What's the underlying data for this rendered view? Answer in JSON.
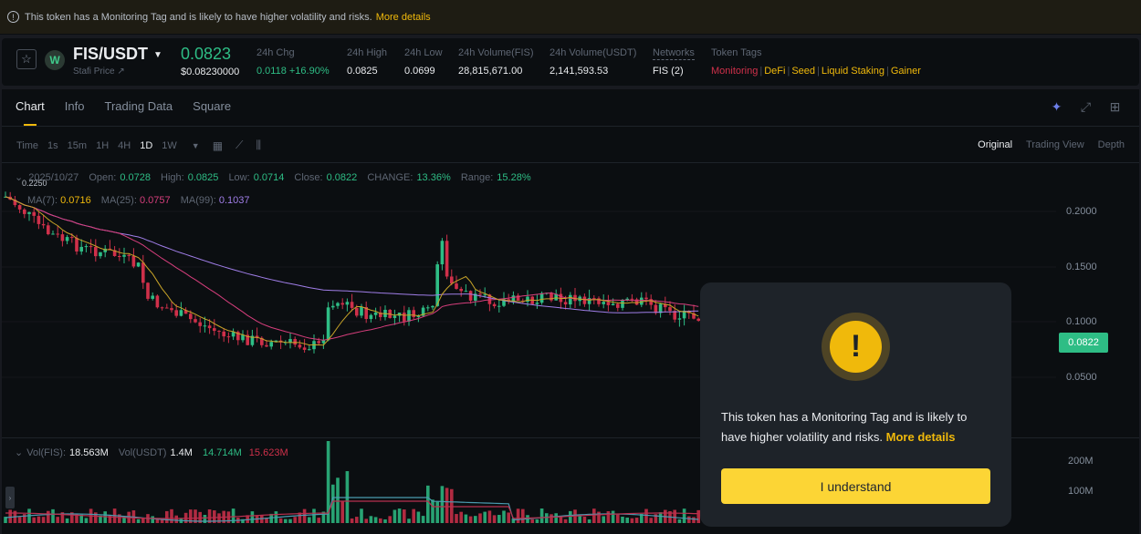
{
  "banner": {
    "text": "This token has a Monitoring Tag and is likely to have higher volatility and risks.",
    "more": "More details"
  },
  "ticker": {
    "pair": "FIS/USDT",
    "sub": "Stafi Price",
    "last": "0.0823",
    "last_usd": "$0.08230000",
    "stats": [
      {
        "label": "24h Chg",
        "value": "0.0118 +16.90%",
        "green": true
      },
      {
        "label": "24h High",
        "value": "0.0825"
      },
      {
        "label": "24h Low",
        "value": "0.0699"
      },
      {
        "label": "24h Volume(FIS)",
        "value": "28,815,671.00"
      },
      {
        "label": "24h Volume(USDT)",
        "value": "2,141,593.53"
      }
    ],
    "networks_label": "Networks",
    "networks_value": "FIS (2)",
    "tags_label": "Token Tags",
    "tags": [
      "Monitoring",
      "DeFi",
      "Seed",
      "Liquid Staking",
      "Gainer"
    ]
  },
  "tabs": [
    "Chart",
    "Info",
    "Trading Data",
    "Square"
  ],
  "toolbar": {
    "intervals": [
      "Time",
      "1s",
      "15m",
      "1H",
      "4H",
      "1D",
      "1W"
    ],
    "active": "1D",
    "view_modes": [
      "Original",
      "Trading View",
      "Depth"
    ],
    "active_view": "Original"
  },
  "ohlc": {
    "date": "2025/10/27",
    "open_label": "Open:",
    "open": "0.0728",
    "high_label": "High:",
    "high": "0.0825",
    "low_label": "Low:",
    "low": "0.0714",
    "close_label": "Close:",
    "close": "0.0822",
    "change_label": "CHANGE:",
    "change": "13.36%",
    "range_label": "Range:",
    "range": "15.28%"
  },
  "ma": {
    "ma7_label": "MA(7):",
    "ma7": "0.0716",
    "ma25_label": "MA(25):",
    "ma25": "0.0757",
    "ma99_label": "MA(99):",
    "ma99": "0.1037"
  },
  "volume": {
    "fis_label": "Vol(FIS):",
    "fis": "18.563M",
    "usdt_label": "Vol(USDT)",
    "usdt": "1.4M",
    "ma1": "14.714M",
    "ma2": "15.623M"
  },
  "axis": {
    "price_ticks": [
      "0.2000",
      "0.1500",
      "0.1000",
      "0.0500"
    ],
    "volume_ticks": [
      "200M",
      "100M"
    ],
    "current_price": "0.0822",
    "peak_label": "0.2250"
  },
  "modal": {
    "icon": "!",
    "text": "This token has a Monitoring Tag and is likely to have higher volatility and risks.",
    "more": "More details",
    "button": "I understand"
  },
  "colors": {
    "up": "#2ebd85",
    "down": "#cf304a",
    "accent": "#f0b90b",
    "button": "#fcd535"
  }
}
